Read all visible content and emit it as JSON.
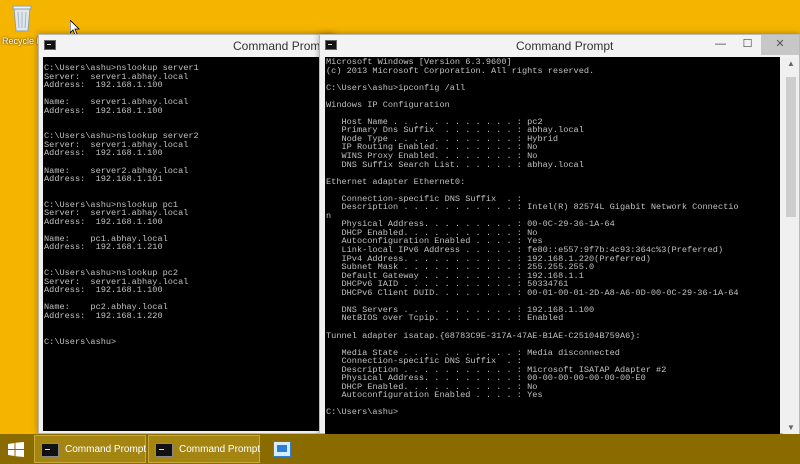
{
  "desktop": {
    "recycle_bin_label": "Recycle B"
  },
  "window_left": {
    "title": "Command Prompt",
    "console_text": "C:\\Users\\ashu>nslookup server1\nServer:  server1.abhay.local\nAddress:  192.168.1.100\n\nName:    server1.abhay.local\nAddress:  192.168.1.100\n\n\nC:\\Users\\ashu>nslookup server2\nServer:  server1.abhay.local\nAddress:  192.168.1.100\n\nName:    server2.abhay.local\nAddress:  192.168.1.101\n\n\nC:\\Users\\ashu>nslookup pc1\nServer:  server1.abhay.local\nAddress:  192.168.1.100\n\nName:    pc1.abhay.local\nAddress:  192.168.1.210\n\n\nC:\\Users\\ashu>nslookup pc2\nServer:  server1.abhay.local\nAddress:  192.168.1.100\n\nName:    pc2.abhay.local\nAddress:  192.168.1.220\n\n\nC:\\Users\\ashu>"
  },
  "window_right": {
    "title": "Command Prompt",
    "controls": {
      "minimize": "—",
      "maximize": "☐",
      "close": "✕"
    },
    "console_text": "Microsoft Windows [Version 6.3.9600]\n(c) 2013 Microsoft Corporation. All rights reserved.\n\nC:\\Users\\ashu>ipconfig /all\n\nWindows IP Configuration\n\n   Host Name . . . . . . . . . . . . : pc2\n   Primary Dns Suffix  . . . . . . . : abhay.local\n   Node Type . . . . . . . . . . . . : Hybrid\n   IP Routing Enabled. . . . . . . . : No\n   WINS Proxy Enabled. . . . . . . . : No\n   DNS Suffix Search List. . . . . . : abhay.local\n\nEthernet adapter Ethernet0:\n\n   Connection-specific DNS Suffix  . :\n   Description . . . . . . . . . . . : Intel(R) 82574L Gigabit Network Connectio\nn\n   Physical Address. . . . . . . . . : 00-0C-29-36-1A-64\n   DHCP Enabled. . . . . . . . . . . : No\n   Autoconfiguration Enabled . . . . : Yes\n   Link-local IPv6 Address . . . . . : fe80::e557:9f7b:4c93:364c%3(Preferred)\n   IPv4 Address. . . . . . . . . . . : 192.168.1.220(Preferred)\n   Subnet Mask . . . . . . . . . . . : 255.255.255.0\n   Default Gateway . . . . . . . . . : 192.168.1.1\n   DHCPv6 IAID . . . . . . . . . . . : 50334761\n   DHCPv6 Client DUID. . . . . . . . : 00-01-00-01-2D-A8-A6-0D-00-0C-29-36-1A-64\n\n   DNS Servers . . . . . . . . . . . : 192.168.1.100\n   NetBIOS over Tcpip. . . . . . . . : Enabled\n\nTunnel adapter isatap.{68783C9E-317A-47AE-B1AE-C25104B759A6}:\n\n   Media State . . . . . . . . . . . : Media disconnected\n   Connection-specific DNS Suffix  . :\n   Description . . . . . . . . . . . : Microsoft ISATAP Adapter #2\n   Physical Address. . . . . . . . . : 00-00-00-00-00-00-00-E0\n   DHCP Enabled. . . . . . . . . . . : No\n   Autoconfiguration Enabled . . . . : Yes\n\nC:\\Users\\ashu>"
  },
  "taskbar": {
    "buttons": [
      {
        "label": "Command Prompt"
      },
      {
        "label": "Command Prompt"
      }
    ]
  },
  "colors": {
    "desktop_background": "#f5b400",
    "taskbar": "#8a6b00",
    "console_background": "#000000",
    "console_text": "#c0c0c0"
  },
  "icons": {
    "desktop": "recycle-bin-icon",
    "window": "command-prompt-icon",
    "start": "windows-logo-icon",
    "pinned": "server-manager-icon",
    "cursor": "mouse-pointer-icon"
  }
}
